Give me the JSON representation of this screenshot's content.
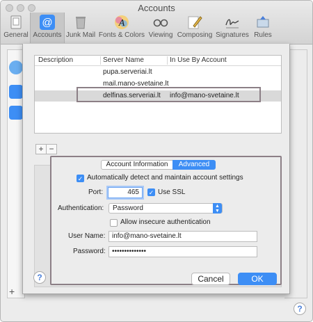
{
  "window": {
    "title": "Accounts"
  },
  "toolbar": {
    "items": [
      {
        "label": "General",
        "icon": "general-icon"
      },
      {
        "label": "Accounts",
        "icon": "accounts-at-icon"
      },
      {
        "label": "Junk Mail",
        "icon": "junk-mail-icon"
      },
      {
        "label": "Fonts & Colors",
        "icon": "fonts-colors-icon"
      },
      {
        "label": "Viewing",
        "icon": "viewing-glasses-icon"
      },
      {
        "label": "Composing",
        "icon": "composing-pencil-icon"
      },
      {
        "label": "Signatures",
        "icon": "signatures-icon"
      },
      {
        "label": "Rules",
        "icon": "rules-icon"
      }
    ],
    "active": "Accounts"
  },
  "server_table": {
    "headers": [
      "Description",
      "Server Name",
      "In Use By Account"
    ],
    "rows": [
      {
        "description": "",
        "server": "pupa.serveriai.lt",
        "account": ""
      },
      {
        "description": "",
        "server": "mail.mano-svetaine.lt",
        "account": ""
      },
      {
        "description": "",
        "server": "delfinas.serveriai.lt",
        "account": "info@mano-svetaine.lt"
      }
    ],
    "selected_row": 2,
    "add_label": "+",
    "remove_label": "−"
  },
  "dialog": {
    "tabs": {
      "first": "Account Information",
      "second": "Advanced",
      "active": "Advanced"
    },
    "auto_detect_label": "Automatically detect and maintain account settings",
    "auto_detect_checked": true,
    "port_label": "Port:",
    "port_value": "465",
    "use_ssl_label": "Use SSL",
    "use_ssl_checked": true,
    "auth_label": "Authentication:",
    "auth_value": "Password",
    "insecure_label": "Allow insecure authentication",
    "insecure_checked": false,
    "username_label": "User Name:",
    "username_value": "info@mano-svetaine.lt",
    "password_label": "Password:",
    "password_value": "••••••••••••••",
    "help_label": "?",
    "cancel_label": "Cancel",
    "ok_label": "OK"
  },
  "background": {
    "help_label": "?",
    "add_label": "+"
  },
  "colors": {
    "accent": "#3d8ef5",
    "annotation_border": "#8c7f86",
    "selected_row": "#d9d9d9"
  }
}
